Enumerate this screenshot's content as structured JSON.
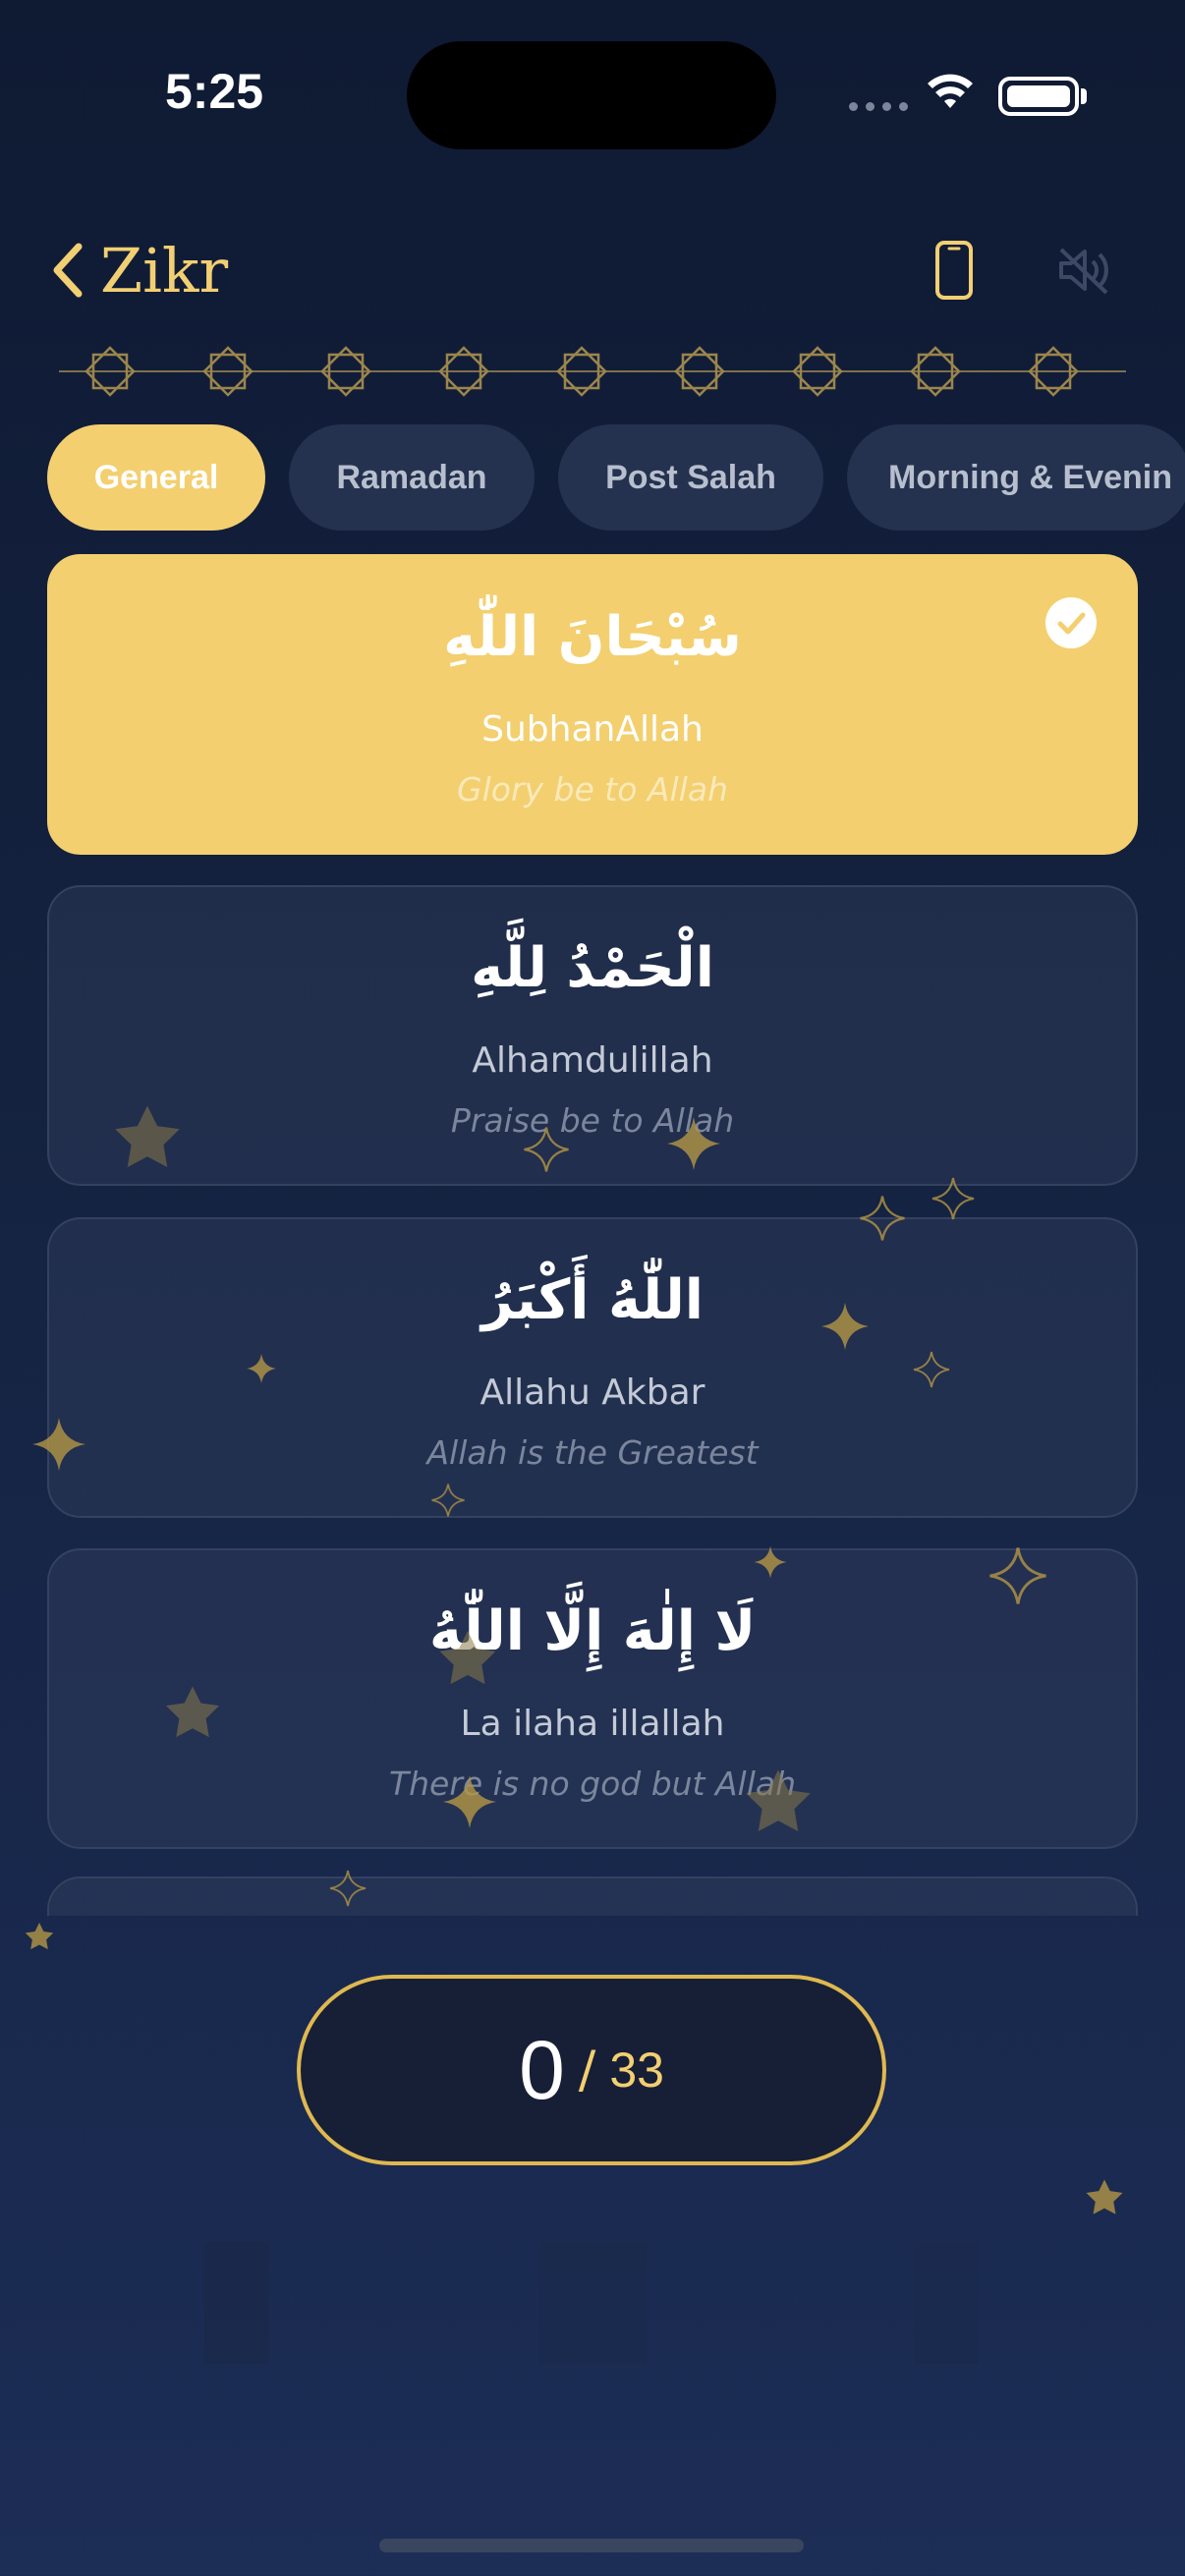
{
  "status_bar": {
    "time": "5:25"
  },
  "header": {
    "title": "Zikr",
    "back_icon": "chevron-left-icon",
    "phone_icon": "phone-vibrate-icon",
    "mute_icon": "speaker-muted-icon"
  },
  "tabs": [
    {
      "label": "General",
      "active": true
    },
    {
      "label": "Ramadan",
      "active": false
    },
    {
      "label": "Post Salah",
      "active": false
    },
    {
      "label": "Morning & Evenin",
      "active": false
    }
  ],
  "dhikr_list": [
    {
      "arabic": "سُبْحَانَ اللّٰهِ",
      "transliteration": "SubhanAllah",
      "meaning": "Glory be to Allah",
      "selected": true
    },
    {
      "arabic": "الْحَمْدُ لِلَّهِ",
      "transliteration": "Alhamdulillah",
      "meaning": "Praise be to Allah",
      "selected": false
    },
    {
      "arabic": "اللّٰهُ أَكْبَرُ",
      "transliteration": "Allahu Akbar",
      "meaning": "Allah is the Greatest",
      "selected": false
    },
    {
      "arabic": "لَا إِلٰهَ إِلَّا اللّٰهُ",
      "transliteration": "La ilaha illallah",
      "meaning": "There is no god but Allah",
      "selected": false
    }
  ],
  "counter": {
    "count": "0",
    "separator": "/",
    "target": "33"
  },
  "colors": {
    "accent": "#f3cf6f",
    "background": "#14223f",
    "card": "#25324f"
  }
}
